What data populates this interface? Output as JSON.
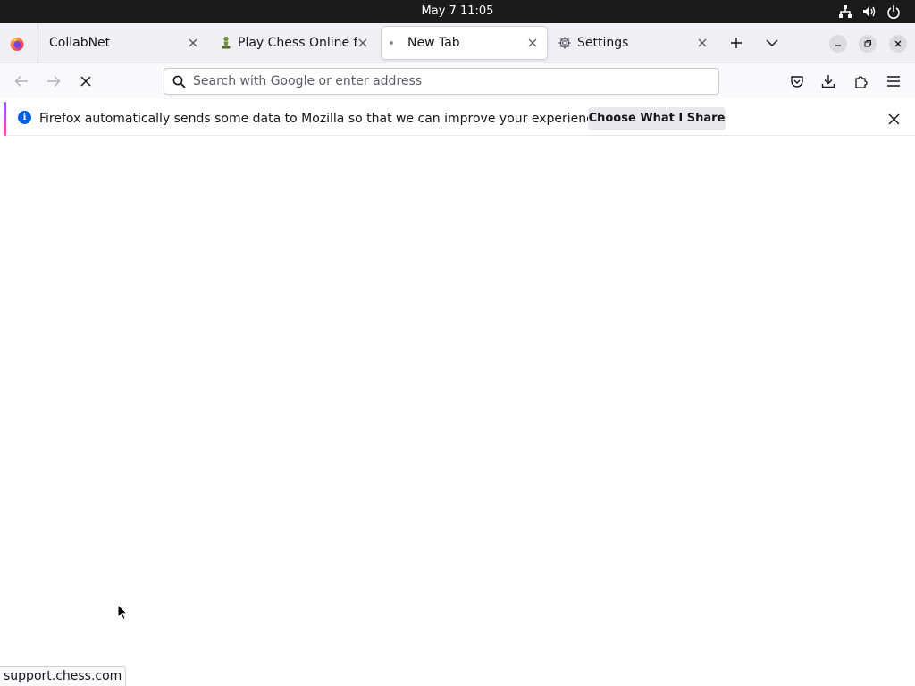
{
  "system": {
    "clock": "May 7  11:05",
    "tray_icons": [
      "network-icon",
      "volume-icon",
      "power-icon"
    ]
  },
  "tabs": [
    {
      "title": "CollabNet",
      "icon": "none",
      "selected": false
    },
    {
      "title": "Play Chess Online for Free",
      "icon": "chess-pawn-icon",
      "selected": false
    },
    {
      "title": "New Tab",
      "icon": "loading-dot-icon",
      "selected": true
    },
    {
      "title": "Settings",
      "icon": "gear-icon",
      "selected": false
    }
  ],
  "toolbar": {
    "url_placeholder": "Search with Google or enter address",
    "url_value": ""
  },
  "notification": {
    "message": "Firefox automatically sends some data to Mozilla so that we can improve your experience.",
    "button_label": "Choose What I Share"
  },
  "status_bar": {
    "link": "support.chess.com"
  },
  "colors": {
    "accent": "#0060df",
    "tabstrip_bg": "#f0f0f4",
    "toolbar_bg": "#f9f9fb",
    "topbar_bg": "#1b1b1b"
  }
}
